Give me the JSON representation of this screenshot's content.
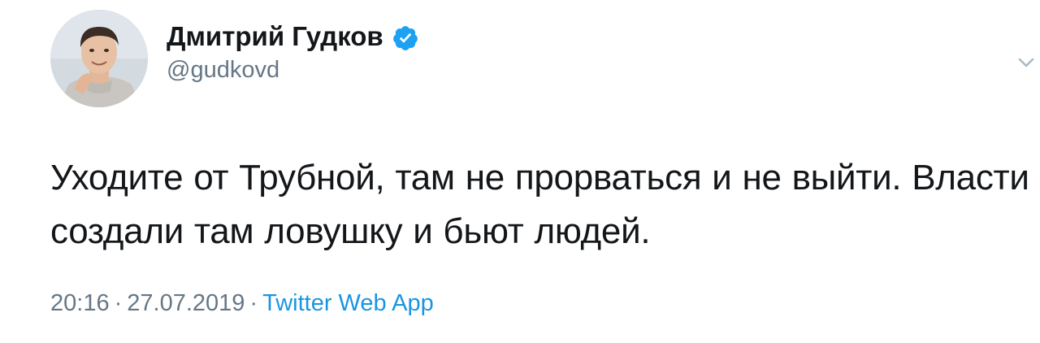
{
  "author": {
    "display_name": "Дмитрий Гудков",
    "handle": "@gudkovd",
    "verified": true,
    "avatar_icon": "profile-photo"
  },
  "tweet": {
    "text": "Уходите от Трубной, там не прорваться и не выйти. Власти создали там ловушку и бьют людей.",
    "time": "20:16",
    "date": "27.07.2019",
    "separator": "·",
    "source": "Twitter Web App"
  },
  "icons": {
    "verified": "verified-badge-icon",
    "menu": "chevron-down-icon"
  },
  "colors": {
    "text": "#14171a",
    "secondary": "#657786",
    "link": "#1b95e0",
    "verified": "#1da1f2"
  }
}
